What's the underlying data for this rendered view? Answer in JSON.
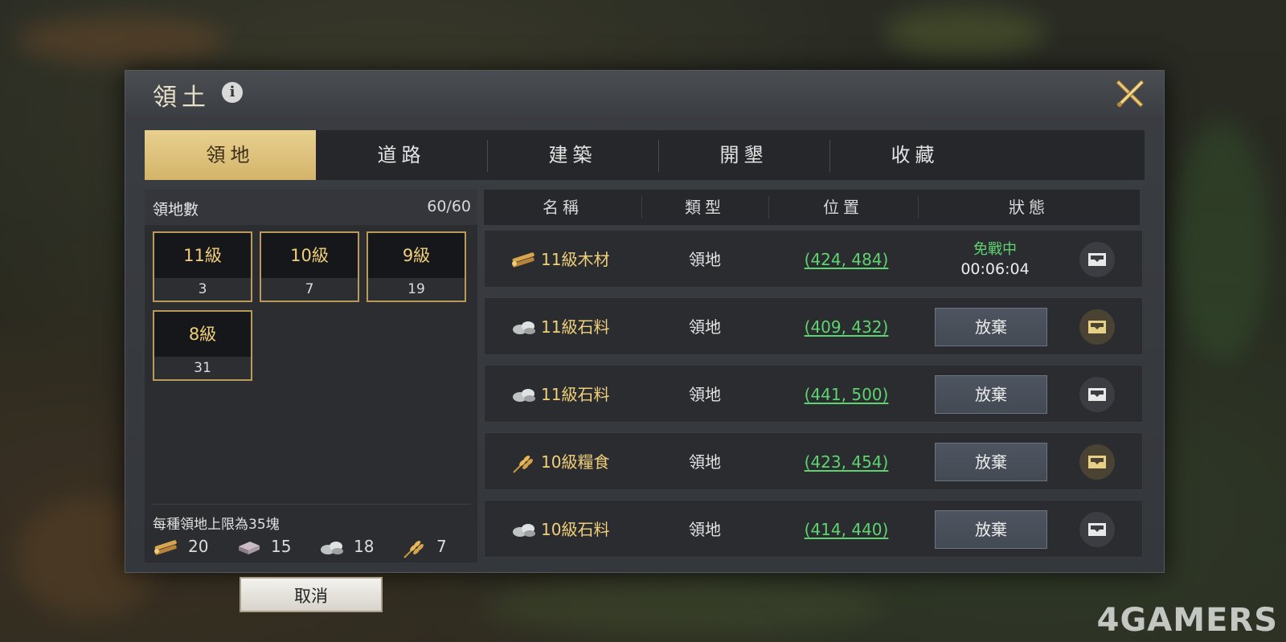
{
  "dialog": {
    "title": "領土",
    "info_icon": "i"
  },
  "tabs": [
    {
      "label": "領地",
      "active": true
    },
    {
      "label": "道路",
      "active": false
    },
    {
      "label": "建築",
      "active": false
    },
    {
      "label": "開墾",
      "active": false
    },
    {
      "label": "收藏",
      "active": false
    }
  ],
  "summary": {
    "title": "領地數",
    "count": "60/60",
    "levels": [
      {
        "level": "11級",
        "count": "3"
      },
      {
        "level": "10級",
        "count": "7"
      },
      {
        "level": "9級",
        "count": "19"
      },
      {
        "level": "8級",
        "count": "31"
      }
    ],
    "limit_text": "每種領地上限為35塊",
    "resources": [
      {
        "icon": "wood-icon",
        "value": "20"
      },
      {
        "icon": "iron-icon",
        "value": "15"
      },
      {
        "icon": "stone-icon",
        "value": "18"
      },
      {
        "icon": "grain-icon",
        "value": "7"
      }
    ],
    "cancel_label": "取消"
  },
  "table": {
    "headers": [
      "名稱",
      "類型",
      "位置",
      "狀態"
    ],
    "rows": [
      {
        "icon": "wood-icon",
        "name": "11級木材",
        "type": "領地",
        "position": "(424, 484)",
        "status": "protected",
        "status_label": "免戰中",
        "timer": "00:06:04",
        "favorite": false
      },
      {
        "icon": "stone-icon",
        "name": "11級石料",
        "type": "領地",
        "position": "(409, 432)",
        "status": "button",
        "button_label": "放棄",
        "favorite": true
      },
      {
        "icon": "stone-icon",
        "name": "11級石料",
        "type": "領地",
        "position": "(441, 500)",
        "status": "button",
        "button_label": "放棄",
        "favorite": false
      },
      {
        "icon": "grain-icon",
        "name": "10級糧食",
        "type": "領地",
        "position": "(423, 454)",
        "status": "button",
        "button_label": "放棄",
        "favorite": true
      },
      {
        "icon": "stone-icon",
        "name": "10級石料",
        "type": "領地",
        "position": "(414, 440)",
        "status": "button",
        "button_label": "放棄",
        "favorite": false
      }
    ]
  },
  "colors": {
    "accent_gold": "#f0cf7a",
    "coord_green": "#5ed470",
    "tab_active": "#d4b46a"
  },
  "watermark": "4GAMERS"
}
